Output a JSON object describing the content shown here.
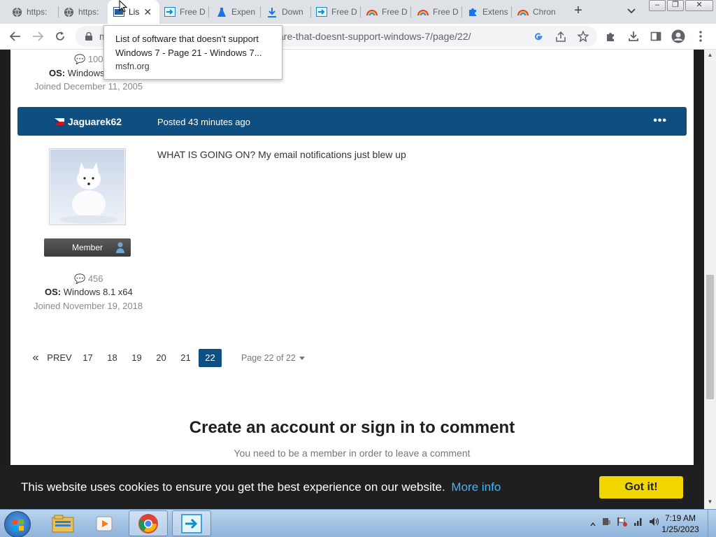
{
  "browser": {
    "tabs": [
      {
        "label": "https:",
        "icon": "globe-icon"
      },
      {
        "label": "https:",
        "icon": "globe-icon"
      },
      {
        "label": "Lis",
        "icon": "msfn-icon",
        "active": true
      },
      {
        "label": "Free D",
        "icon": "freedownload-icon"
      },
      {
        "label": "Expen",
        "icon": "flask-icon"
      },
      {
        "label": "Down",
        "icon": "download-icon"
      },
      {
        "label": "Free D",
        "icon": "freedownload-icon"
      },
      {
        "label": "Free D",
        "icon": "rainbow-icon"
      },
      {
        "label": "Free D",
        "icon": "rainbow-icon"
      },
      {
        "label": "Extens",
        "icon": "puzzle-icon"
      },
      {
        "label": "Chron",
        "icon": "rainbow-icon"
      }
    ],
    "url_start": "m",
    "url_tail": "are-that-doesnt-support-windows-7/page/22/",
    "tooltip": {
      "title": "List of software that doesn't support Windows 7 - Page 21 - Windows 7...",
      "host": "msfn.org"
    }
  },
  "previous_author": {
    "post_count": "100",
    "os_label": "OS:",
    "os_value": "Windows",
    "joined": "Joined December 11, 2005"
  },
  "post": {
    "author": "Jaguarek62",
    "date": "Posted 43 minutes ago",
    "menu": "•••",
    "body": "WHAT IS GOING ON? My email notifications just blew up",
    "badge": "Member",
    "post_count": "456",
    "os_label": "OS:",
    "os_value": "Windows 8.1 x64",
    "joined": "Joined November 19, 2018"
  },
  "pagination": {
    "first": "«",
    "prev": "PREV",
    "pages": [
      "17",
      "18",
      "19",
      "20",
      "21",
      "22"
    ],
    "current": "22",
    "info": "Page 22 of 22"
  },
  "signin": {
    "title": "Create an account or sign in to comment",
    "subtitle": "You need to be a member in order to leave a comment"
  },
  "cookie": {
    "text": "This website uses cookies to ensure you get the best experience on our website.",
    "link": "More info",
    "button": "Got it!"
  },
  "taskbar": {
    "time": "7:19 AM",
    "date": "1/25/2023"
  },
  "colors": {
    "post_header": "#0e4e80",
    "cookie_button": "#f1d600",
    "cookie_link": "#41b6f5"
  }
}
